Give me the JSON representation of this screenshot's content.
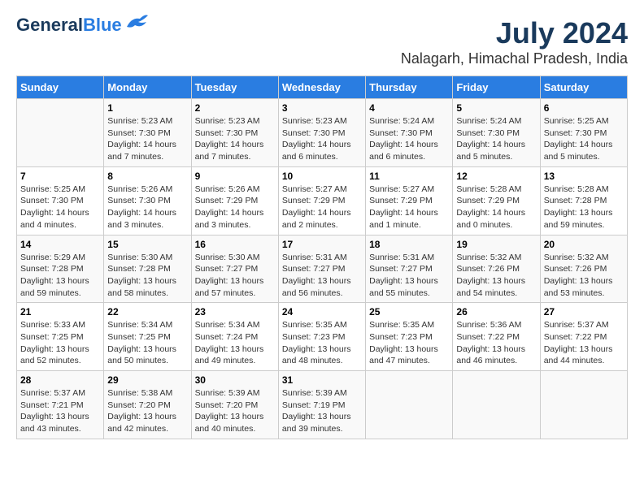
{
  "logo": {
    "line1": "General",
    "line2": "Blue"
  },
  "title": "July 2024",
  "subtitle": "Nalagarh, Himachal Pradesh, India",
  "days_of_week": [
    "Sunday",
    "Monday",
    "Tuesday",
    "Wednesday",
    "Thursday",
    "Friday",
    "Saturday"
  ],
  "weeks": [
    [
      {
        "day": "",
        "info": ""
      },
      {
        "day": "1",
        "info": "Sunrise: 5:23 AM\nSunset: 7:30 PM\nDaylight: 14 hours\nand 7 minutes."
      },
      {
        "day": "2",
        "info": "Sunrise: 5:23 AM\nSunset: 7:30 PM\nDaylight: 14 hours\nand 7 minutes."
      },
      {
        "day": "3",
        "info": "Sunrise: 5:23 AM\nSunset: 7:30 PM\nDaylight: 14 hours\nand 6 minutes."
      },
      {
        "day": "4",
        "info": "Sunrise: 5:24 AM\nSunset: 7:30 PM\nDaylight: 14 hours\nand 6 minutes."
      },
      {
        "day": "5",
        "info": "Sunrise: 5:24 AM\nSunset: 7:30 PM\nDaylight: 14 hours\nand 5 minutes."
      },
      {
        "day": "6",
        "info": "Sunrise: 5:25 AM\nSunset: 7:30 PM\nDaylight: 14 hours\nand 5 minutes."
      }
    ],
    [
      {
        "day": "7",
        "info": "Sunrise: 5:25 AM\nSunset: 7:30 PM\nDaylight: 14 hours\nand 4 minutes."
      },
      {
        "day": "8",
        "info": "Sunrise: 5:26 AM\nSunset: 7:30 PM\nDaylight: 14 hours\nand 3 minutes."
      },
      {
        "day": "9",
        "info": "Sunrise: 5:26 AM\nSunset: 7:29 PM\nDaylight: 14 hours\nand 3 minutes."
      },
      {
        "day": "10",
        "info": "Sunrise: 5:27 AM\nSunset: 7:29 PM\nDaylight: 14 hours\nand 2 minutes."
      },
      {
        "day": "11",
        "info": "Sunrise: 5:27 AM\nSunset: 7:29 PM\nDaylight: 14 hours\nand 1 minute."
      },
      {
        "day": "12",
        "info": "Sunrise: 5:28 AM\nSunset: 7:29 PM\nDaylight: 14 hours\nand 0 minutes."
      },
      {
        "day": "13",
        "info": "Sunrise: 5:28 AM\nSunset: 7:28 PM\nDaylight: 13 hours\nand 59 minutes."
      }
    ],
    [
      {
        "day": "14",
        "info": "Sunrise: 5:29 AM\nSunset: 7:28 PM\nDaylight: 13 hours\nand 59 minutes."
      },
      {
        "day": "15",
        "info": "Sunrise: 5:30 AM\nSunset: 7:28 PM\nDaylight: 13 hours\nand 58 minutes."
      },
      {
        "day": "16",
        "info": "Sunrise: 5:30 AM\nSunset: 7:27 PM\nDaylight: 13 hours\nand 57 minutes."
      },
      {
        "day": "17",
        "info": "Sunrise: 5:31 AM\nSunset: 7:27 PM\nDaylight: 13 hours\nand 56 minutes."
      },
      {
        "day": "18",
        "info": "Sunrise: 5:31 AM\nSunset: 7:27 PM\nDaylight: 13 hours\nand 55 minutes."
      },
      {
        "day": "19",
        "info": "Sunrise: 5:32 AM\nSunset: 7:26 PM\nDaylight: 13 hours\nand 54 minutes."
      },
      {
        "day": "20",
        "info": "Sunrise: 5:32 AM\nSunset: 7:26 PM\nDaylight: 13 hours\nand 53 minutes."
      }
    ],
    [
      {
        "day": "21",
        "info": "Sunrise: 5:33 AM\nSunset: 7:25 PM\nDaylight: 13 hours\nand 52 minutes."
      },
      {
        "day": "22",
        "info": "Sunrise: 5:34 AM\nSunset: 7:25 PM\nDaylight: 13 hours\nand 50 minutes."
      },
      {
        "day": "23",
        "info": "Sunrise: 5:34 AM\nSunset: 7:24 PM\nDaylight: 13 hours\nand 49 minutes."
      },
      {
        "day": "24",
        "info": "Sunrise: 5:35 AM\nSunset: 7:23 PM\nDaylight: 13 hours\nand 48 minutes."
      },
      {
        "day": "25",
        "info": "Sunrise: 5:35 AM\nSunset: 7:23 PM\nDaylight: 13 hours\nand 47 minutes."
      },
      {
        "day": "26",
        "info": "Sunrise: 5:36 AM\nSunset: 7:22 PM\nDaylight: 13 hours\nand 46 minutes."
      },
      {
        "day": "27",
        "info": "Sunrise: 5:37 AM\nSunset: 7:22 PM\nDaylight: 13 hours\nand 44 minutes."
      }
    ],
    [
      {
        "day": "28",
        "info": "Sunrise: 5:37 AM\nSunset: 7:21 PM\nDaylight: 13 hours\nand 43 minutes."
      },
      {
        "day": "29",
        "info": "Sunrise: 5:38 AM\nSunset: 7:20 PM\nDaylight: 13 hours\nand 42 minutes."
      },
      {
        "day": "30",
        "info": "Sunrise: 5:39 AM\nSunset: 7:20 PM\nDaylight: 13 hours\nand 40 minutes."
      },
      {
        "day": "31",
        "info": "Sunrise: 5:39 AM\nSunset: 7:19 PM\nDaylight: 13 hours\nand 39 minutes."
      },
      {
        "day": "",
        "info": ""
      },
      {
        "day": "",
        "info": ""
      },
      {
        "day": "",
        "info": ""
      }
    ]
  ]
}
